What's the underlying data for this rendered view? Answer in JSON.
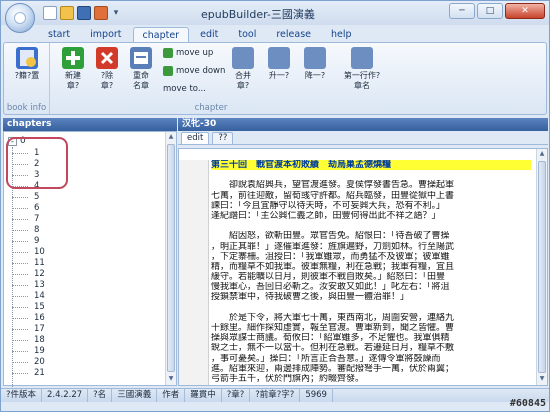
{
  "window": {
    "title": "epubBuilder-三國演義",
    "min_label": "─",
    "max_label": "□",
    "close_label": "✕"
  },
  "quick_access": {
    "dropdown_glyph": "▾"
  },
  "ribbon": {
    "tabs": [
      {
        "label": "start"
      },
      {
        "label": "import"
      },
      {
        "label": "chapter"
      },
      {
        "label": "edit"
      },
      {
        "label": "tool"
      },
      {
        "label": "release"
      },
      {
        "label": "help"
      }
    ],
    "groups": {
      "book_info": {
        "label": "book info",
        "button_label": "?籍?置",
        "icon_color": "#3a6fcf"
      },
      "chapter": {
        "label": "chapter",
        "buttons": [
          {
            "label": "新建\n章?",
            "icon": "add-icon",
            "color": "#2f9f3a"
          },
          {
            "label": "?除\n章?",
            "icon": "delete-icon",
            "color": "#d23a2a"
          },
          {
            "label": "重命\n名章",
            "icon": "rename-icon",
            "color": "#5a7fb8"
          }
        ],
        "move_up": "move up",
        "move_down": "move down",
        "move_to": "move to...",
        "merge_label": "合并\n章?",
        "level_up": "升一?",
        "level_down": "降一?",
        "first_line_label": "第一行作?章名"
      }
    }
  },
  "chapters_panel": {
    "header": "chapters",
    "root_label": "0",
    "expander": "-",
    "items": [
      "1",
      "2",
      "3",
      "4",
      "5",
      "6",
      "7",
      "8",
      "9",
      "10",
      "11",
      "12",
      "13",
      "14",
      "15",
      "16",
      "17",
      "18",
      "19",
      "20",
      "21"
    ]
  },
  "editor_panel": {
    "header": "汉牝-30",
    "doc_tabs": [
      {
        "label": "edit"
      },
      {
        "label": "??"
      }
    ],
    "lines": [
      {
        "text": "第三十回　戰官渡本初敗績　劫烏巢孟德燒糧",
        "highlight": true
      },
      {
        "text": "",
        "highlight": false
      },
      {
        "text": "　　卻說袁紹興兵，望官渡進發。夏侯惇發書告急。曹操起軍",
        "highlight": false
      },
      {
        "text": "七萬，前往迎敵，留荀彧守許都。紹兵臨發，田豐從獄中上書",
        "highlight": false
      },
      {
        "text": "諫曰：「今且宜靜守以待天時，不可妄興大兵，恐有不利。」",
        "highlight": false
      },
      {
        "text": "逢紀譖曰：「主公興仁義之師，田豐何得出此不祥之語？」",
        "highlight": false
      },
      {
        "text": "",
        "highlight": false
      },
      {
        "text": "　　紹因怒，欲斬田豐。眾官告免。紹恨曰：「待吾破了曹操",
        "highlight": false
      },
      {
        "text": "，明正其罪！」遂催軍進發：旌旗遍野，刀劍如林。行至陽武",
        "highlight": false
      },
      {
        "text": "，下定寨柵。沮授曰：「我軍雖眾，而勇猛不及彼軍；彼軍雖",
        "highlight": false
      },
      {
        "text": "精，而糧草不如我軍。彼軍無糧，利在急戰；我軍有糧，宜且",
        "highlight": false
      },
      {
        "text": "緩守。若能曠以日月，則彼軍不戰自敗矣。」紹怒曰：「田豐",
        "highlight": false
      },
      {
        "text": "慢我軍心，吾回日必斬之。汝安敢又如此！」叱左右：「將沮",
        "highlight": false
      },
      {
        "text": "授鎖禁軍中，待我破曹之後，與田豐一體治罪！」",
        "highlight": false
      },
      {
        "text": "",
        "highlight": false
      },
      {
        "text": "　　於是下令，將大軍七十萬，東西南北，周圍安營，連絡九",
        "highlight": false
      },
      {
        "text": "十餘里。細作探知虛實，報至官渡。曹軍新到，聞之皆懼。曹",
        "highlight": false
      },
      {
        "text": "操與眾謀士商議。荀攸曰：「紹軍雖多，不足懼也。我軍俱精",
        "highlight": false
      },
      {
        "text": "銳之士，無不一以當十。但利在急戰。若遷延日月，糧草不敷",
        "highlight": false
      },
      {
        "text": "，事可憂矣。」操曰：「所言正合吾意。」遂傳令軍將鼓譟而",
        "highlight": false
      },
      {
        "text": "進。紹軍來迎，兩邊排成陣勢。審配撥弩手一萬，伏於兩翼；",
        "highlight": false
      },
      {
        "text": "弓箭手五千，伏於門旗內；約畷齊發。",
        "highlight": false
      }
    ]
  },
  "statusbar": {
    "fields": [
      "?件版本",
      "2.4.2.27",
      "?名",
      "三國演義",
      "作者",
      "羅貫中",
      "?章?",
      "?前章?字?",
      "5969"
    ]
  },
  "watermark": "#60845"
}
